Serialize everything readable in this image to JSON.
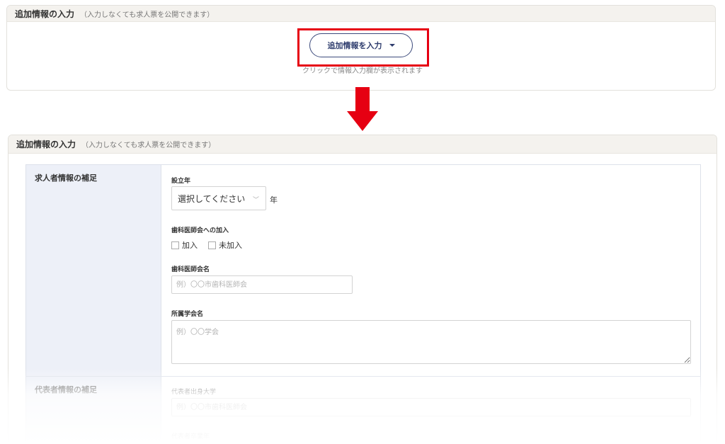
{
  "top_panel": {
    "title": "追加情報の入力",
    "subtitle": "（入力しなくても求人票を公開できます）",
    "expand_button_label": "追加情報を入力",
    "hint": "クリックで情報入力欄が表示されます"
  },
  "bottom_panel": {
    "title": "追加情報の入力",
    "subtitle": "（入力しなくても求人票を公開できます）",
    "sections": [
      {
        "label": "求人者情報の補足",
        "fields": {
          "founded_year": {
            "label": "設立年",
            "select_value": "選択してください",
            "suffix": "年"
          },
          "dental_association": {
            "label": "歯科医師会への加入",
            "options": [
              "加入",
              "未加入"
            ]
          },
          "association_name": {
            "label": "歯科医師会名",
            "placeholder": "例）〇〇市歯科医師会"
          },
          "academic_society": {
            "label": "所属学会名",
            "placeholder": "例）〇〇学会"
          }
        }
      },
      {
        "label": "代表者情報の補足",
        "fields": {
          "representative_university": {
            "label": "代表者出身大学",
            "placeholder": "例）〇〇市歯科医師会"
          },
          "representative_year": {
            "label": "代表者卒業年"
          }
        }
      }
    ]
  },
  "colors": {
    "highlight": "#e60012",
    "arrow": "#e60012",
    "button_border": "#3c4a7c",
    "label_column": "#edf0f8"
  }
}
